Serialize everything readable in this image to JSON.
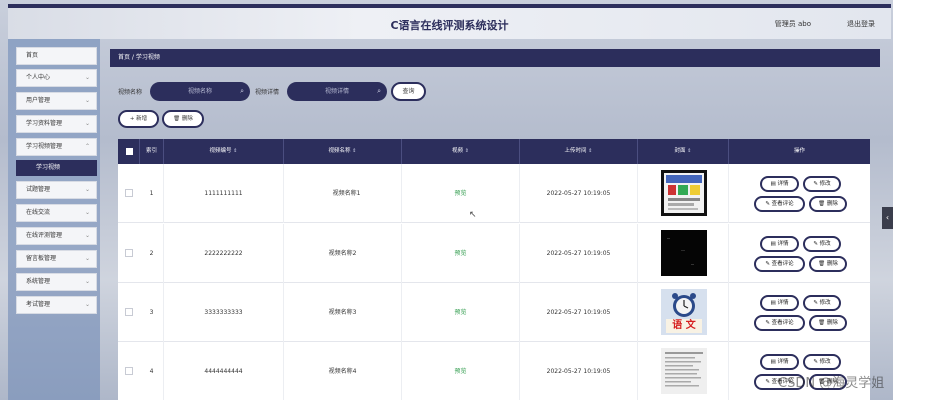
{
  "header": {
    "title": "C语言在线评测系统设计",
    "user_label": "管理员 abo",
    "logout_label": "退出登录"
  },
  "sidebar": {
    "items": [
      {
        "label": "首页"
      },
      {
        "label": "个人中心"
      },
      {
        "label": "用户管理"
      },
      {
        "label": "学习资料管理"
      },
      {
        "label": "学习视频管理"
      },
      {
        "label": "试题管理"
      },
      {
        "label": "在线交流"
      },
      {
        "label": "在线评测管理"
      },
      {
        "label": "留言板管理"
      },
      {
        "label": "系统管理"
      },
      {
        "label": "考试管理"
      }
    ],
    "active_sub": "学习视频"
  },
  "breadcrumb": "首页 / 学习视频",
  "search": {
    "name_label": "视频名称",
    "name_placeholder": "视频名称",
    "detail_label": "视频详情",
    "detail_placeholder": "视频详情",
    "query_button": "查询"
  },
  "actions": {
    "add_label": "+ 新增",
    "delete_label": "删除"
  },
  "table": {
    "columns": [
      "索引",
      "视频编号",
      "视频名称",
      "视频",
      "上传时间",
      "封面",
      "操作"
    ],
    "rows": [
      {
        "index": "1",
        "code": "1111111111",
        "name": "视频名称1",
        "video": "预览",
        "time": "2022-05-27 10:19:05"
      },
      {
        "index": "2",
        "code": "2222222222",
        "name": "视频名称2",
        "video": "预览",
        "time": "2022-05-27 10:19:05"
      },
      {
        "index": "3",
        "code": "3333333333",
        "name": "视频名称3",
        "video": "预览",
        "time": "2022-05-27 10:19:05"
      },
      {
        "index": "4",
        "code": "4444444444",
        "name": "视频名称4",
        "video": "预览",
        "time": "2022-05-27 10:19:05"
      }
    ],
    "op_labels": {
      "detail": "详情",
      "edit": "修改",
      "comments": "查看评论",
      "delete": "删除"
    },
    "row3_cover_text": "语 文"
  },
  "watermark": "CSDN @海灵学姐",
  "colors": {
    "primary": "#2c2e5c",
    "preview_green": "#2e9b4b"
  }
}
